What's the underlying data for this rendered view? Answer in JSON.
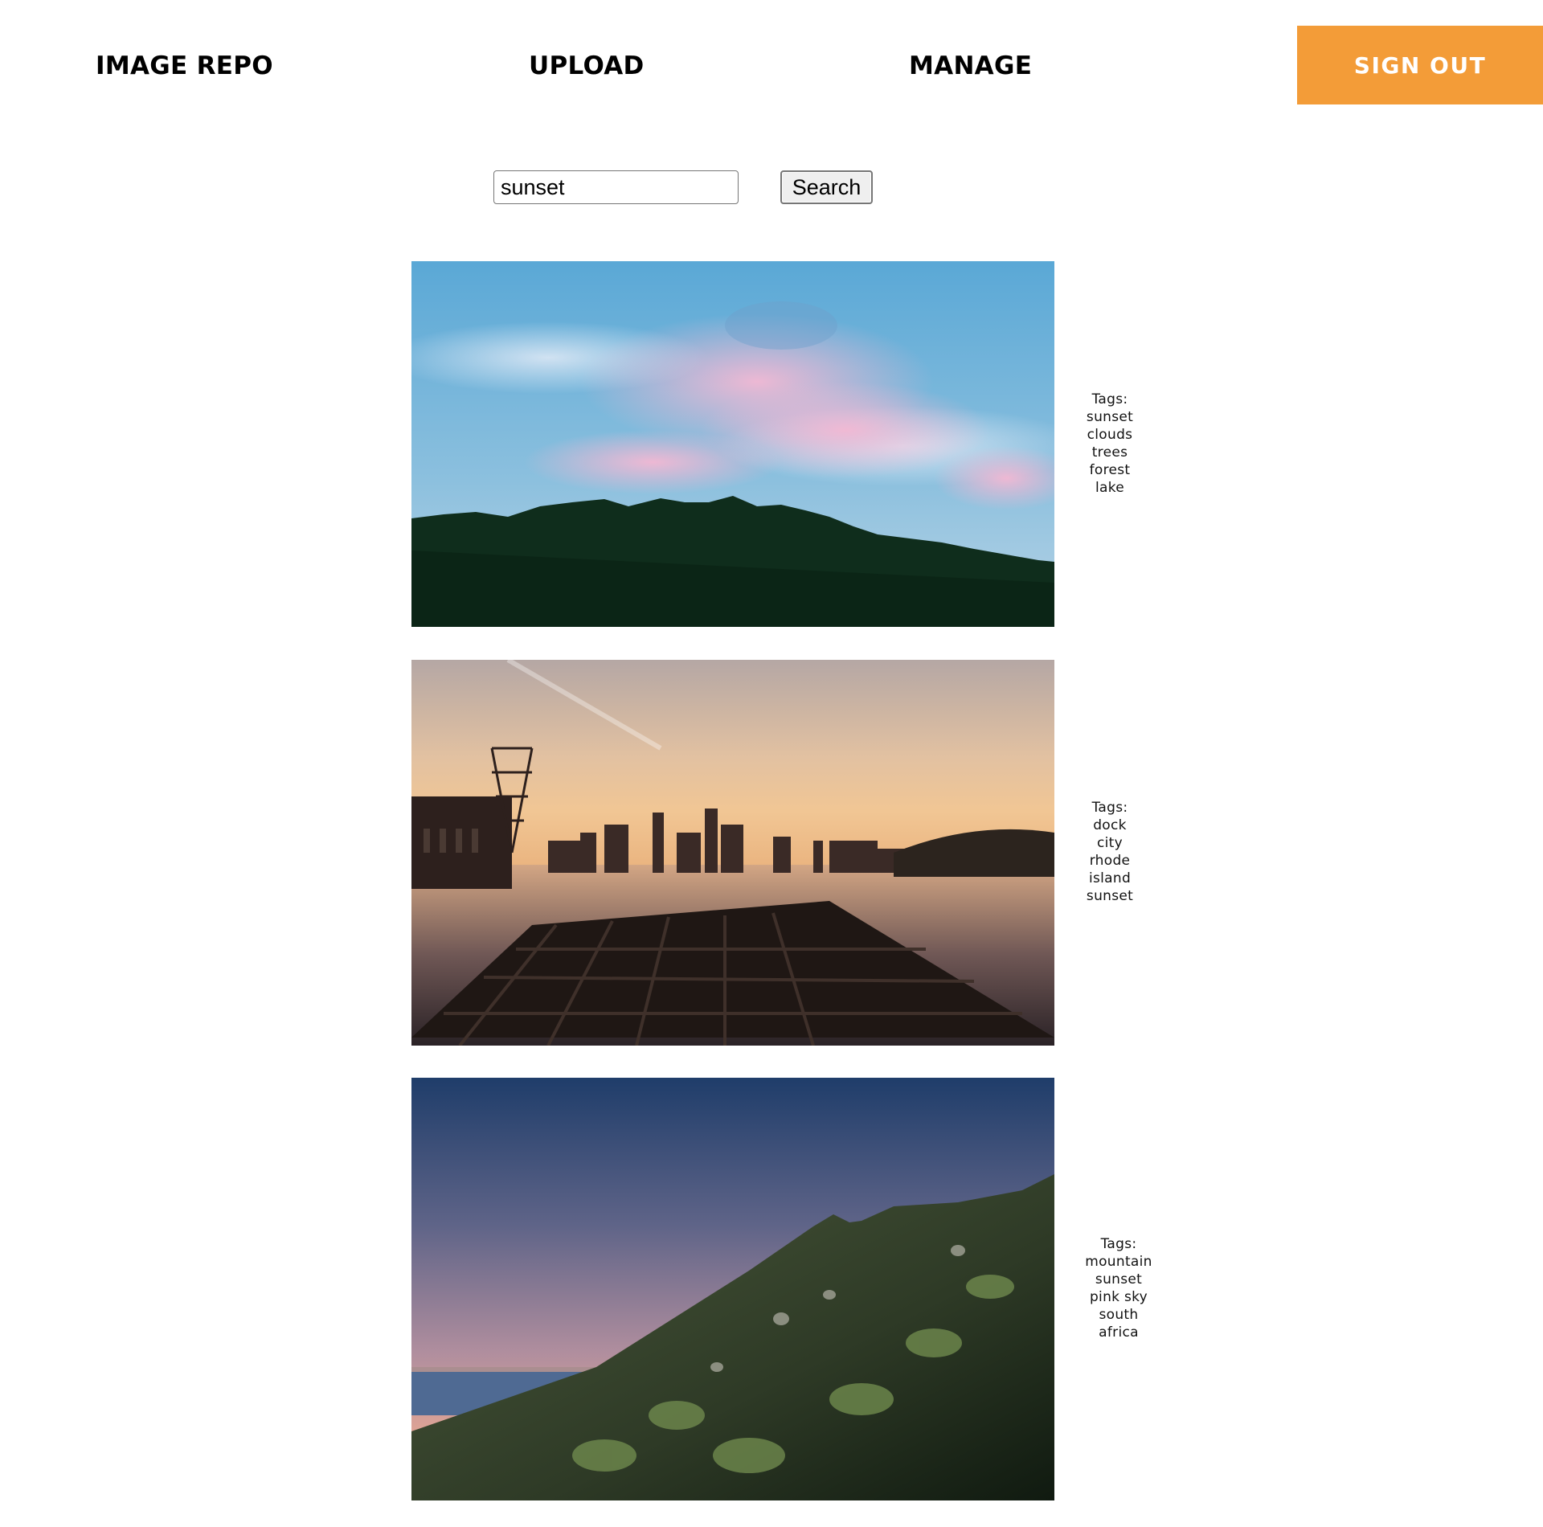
{
  "nav": {
    "brand": "IMAGE REPO",
    "upload": "UPLOAD",
    "manage": "MANAGE",
    "sign_out": "SIGN OUT",
    "accent_color": "#f39c38"
  },
  "search": {
    "value": "sunset",
    "button_label": "Search"
  },
  "results": [
    {
      "image": "sky-clouds-forest-photo",
      "tags_label": "Tags:",
      "tags": [
        "sunset",
        "clouds",
        "trees",
        "forest",
        "lake"
      ]
    },
    {
      "image": "river-dock-city-skyline-photo",
      "tags_label": "Tags:",
      "tags": [
        "dock",
        "city",
        "rhode",
        "island",
        "sunset"
      ]
    },
    {
      "image": "mountain-slope-ocean-photo",
      "tags_label": "Tags:",
      "tags": [
        "mountain",
        "sunset",
        "pink sky",
        "south",
        "africa"
      ]
    }
  ]
}
